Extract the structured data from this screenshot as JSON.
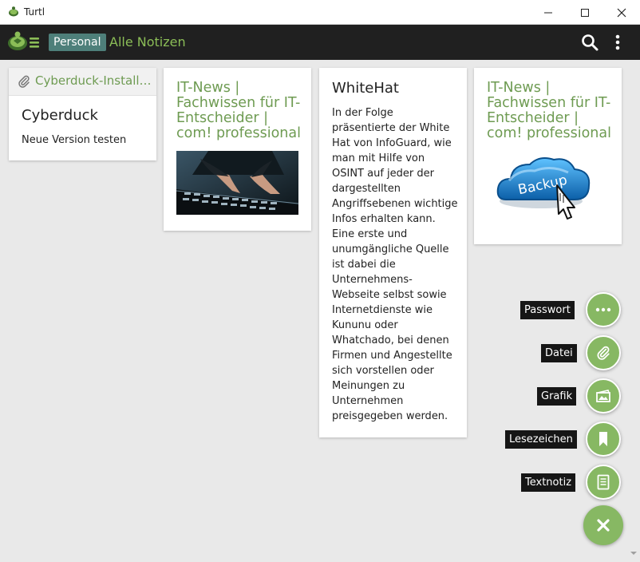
{
  "window": {
    "title": "Turtl",
    "controls": [
      "minimize-icon",
      "maximize-icon",
      "close-icon"
    ]
  },
  "header": {
    "space": "Personal",
    "board_title": "Alle Notizen",
    "icons": [
      "search-icon",
      "more-vertical-icon"
    ]
  },
  "notes": [
    {
      "type": "file",
      "file_name": "Cyberduck-Installer.exe",
      "title": "Cyberduck",
      "text": "Neue Version testen"
    },
    {
      "type": "link",
      "title": "IT-News | Fachwissen für IT-Entscheider | com! professional",
      "image": "keyboard-hands-image"
    },
    {
      "type": "text",
      "title": "WhiteHat",
      "body": "In der Folge präsentierte der White Hat von InfoGuard, wie man mit Hilfe von OSINT auf jeder der dargestellten Angriffsebenen wichtige Infos erhalten kann. Eine erste und unumgängliche Quelle ist dabei die Unternehmens-Webseite selbst sowie Internetdienste wie Kununu oder Whatchado, bei denen Firmen und Angestellte sich vorstellen oder Meinungen zu Unternehmen preisgegeben werden."
    },
    {
      "type": "link",
      "title": "IT-News | Fachwissen für IT-Entscheider | com! professional",
      "image_text": "Backup"
    }
  ],
  "fab_menu": {
    "items": [
      {
        "label": "Passwort",
        "icon": "more-horizontal-icon"
      },
      {
        "label": "Datei",
        "icon": "paperclip-icon"
      },
      {
        "label": "Grafik",
        "icon": "image-icon"
      },
      {
        "label": "Lesezeichen",
        "icon": "bookmark-icon"
      },
      {
        "label": "Textnotiz",
        "icon": "text-note-icon"
      }
    ],
    "close_icon": "close-icon"
  },
  "colors": {
    "accent": "#87b863",
    "link_title": "#6e9b52",
    "space_badge": "#4e7f7a",
    "header_bg": "#202020",
    "page_bg": "#e9e9e9"
  }
}
